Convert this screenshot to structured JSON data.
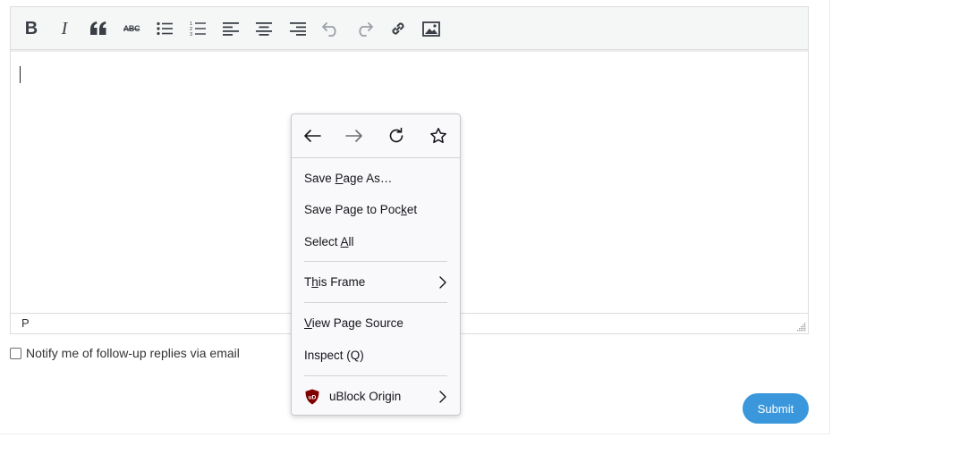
{
  "editor": {
    "toolbar": {
      "buttons": [
        {
          "name": "bold-button",
          "icon": "bold-icon",
          "glyph": "B"
        },
        {
          "name": "italic-button",
          "icon": "italic-icon",
          "glyph": "I"
        },
        {
          "name": "blockquote-button",
          "icon": "quote-icon",
          "glyph": "“"
        },
        {
          "name": "strikethrough-button",
          "icon": "strikethrough-icon",
          "glyph": "ABC"
        },
        {
          "name": "bullet-list-button",
          "icon": "bullet-list-icon"
        },
        {
          "name": "numbered-list-button",
          "icon": "numbered-list-icon"
        },
        {
          "name": "align-left-button",
          "icon": "align-left-icon"
        },
        {
          "name": "align-center-button",
          "icon": "align-center-icon"
        },
        {
          "name": "align-right-button",
          "icon": "align-right-icon"
        },
        {
          "name": "undo-button",
          "icon": "undo-icon"
        },
        {
          "name": "redo-button",
          "icon": "redo-icon"
        },
        {
          "name": "link-button",
          "icon": "link-icon"
        },
        {
          "name": "image-button",
          "icon": "image-icon"
        }
      ]
    },
    "statusbar": {
      "path": "P"
    }
  },
  "form": {
    "notify_label": "Notify me of follow-up replies via email",
    "submit_label": "Submit"
  },
  "context_menu": {
    "nav": {
      "back_icon": "arrow-left-icon",
      "forward_icon": "arrow-right-icon",
      "reload_icon": "reload-icon",
      "bookmark_icon": "star-icon"
    },
    "items": {
      "save_page_as": {
        "before": "Save ",
        "accel": "P",
        "after": "age As…"
      },
      "save_to_pocket": {
        "before": "Save Page to Poc",
        "accel": "k",
        "after": "et"
      },
      "select_all": {
        "before": "Select ",
        "accel": "A",
        "after": "ll"
      },
      "this_frame": {
        "before": "T",
        "accel": "h",
        "after": "is Frame"
      },
      "view_source": {
        "before": "",
        "accel": "V",
        "after": "iew Page Source"
      },
      "inspect": {
        "text": "Inspect (Q)"
      },
      "ublock": {
        "text": "uBlock Origin",
        "icon": "ublock-origin-icon",
        "icon_text": "uD"
      }
    }
  },
  "colors": {
    "submit_bg": "#3b97db",
    "ublock_red": "#800000"
  }
}
